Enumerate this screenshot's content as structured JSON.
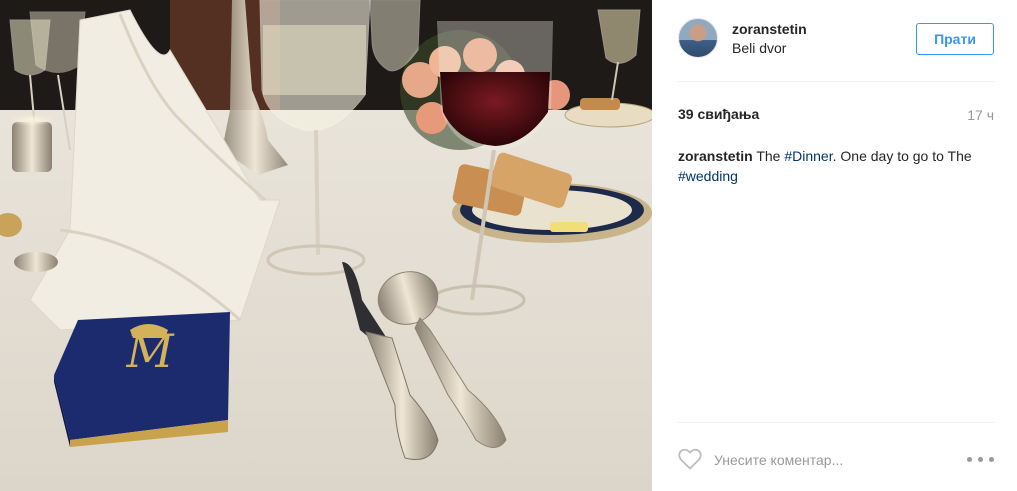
{
  "post": {
    "username": "zoranstetin",
    "location": "Beli dvor",
    "follow_label": "Прати",
    "likes": "39 свиђања",
    "time_ago": "17 ч",
    "caption": {
      "username": "zoranstetin",
      "text_1": " The ",
      "tag_1": "#Dinner",
      "text_2": ". One day to go to The ",
      "tag_2": "#wedding"
    },
    "comment_placeholder": "Унесите коментар..."
  },
  "colors": {
    "accent": "#3897f0",
    "hashtag": "#003569",
    "muted": "#999999",
    "divider": "#efefef"
  },
  "icons": {
    "like": "heart-outline-icon",
    "options": "ellipsis-icon"
  },
  "photo": {
    "description_subject": "dinner table setting"
  }
}
